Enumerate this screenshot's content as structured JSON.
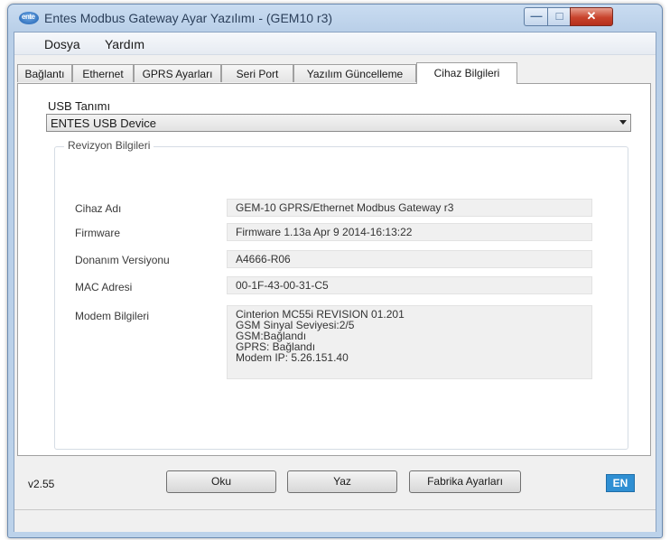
{
  "window": {
    "title": "Entes Modbus Gateway Ayar Yazılımı - (GEM10 r3)",
    "icon_text": "ente",
    "close_glyph": "✕"
  },
  "menu": [
    "Dosya",
    "Yardım"
  ],
  "tabs": [
    {
      "label": "Bağlantı",
      "active": false
    },
    {
      "label": "Ethernet",
      "active": false
    },
    {
      "label": "GPRS Ayarları",
      "active": false
    },
    {
      "label": "Seri Port",
      "active": false
    },
    {
      "label": "Yazılım Güncelleme",
      "active": false
    },
    {
      "label": "Cihaz Bilgileri",
      "active": true
    }
  ],
  "usb": {
    "label": "USB Tanımı",
    "selected": "ENTES USB Device"
  },
  "revision": {
    "title": "Revizyon Bilgileri",
    "fields": [
      {
        "label": "Cihaz Adı",
        "value": "GEM-10 GPRS/Ethernet Modbus Gateway r3"
      },
      {
        "label": "Firmware",
        "value": "Firmware 1.13a  Apr  9 2014-16:13:22"
      },
      {
        "label": "Donanım Versiyonu",
        "value": "A4666-R06"
      },
      {
        "label": "MAC Adresi",
        "value": "00-1F-43-00-31-C5"
      }
    ],
    "modem_label": "Modem Bilgileri",
    "modem_lines": [
      "Cinterion MC55i REVISION 01.201",
      "GSM Sinyal Seviyesi:2/5",
      "GSM:Bağlandı",
      "GPRS: Bağlandı",
      "Modem IP: 5.26.151.40"
    ]
  },
  "footer": {
    "version": "v2.55",
    "read_button": "Oku",
    "write_button": "Yaz",
    "factory_button": "Fabrika Ayarları",
    "language": "EN"
  },
  "colors": {
    "language_badge": "#2f8fd3",
    "close_button": "#c8432c"
  }
}
